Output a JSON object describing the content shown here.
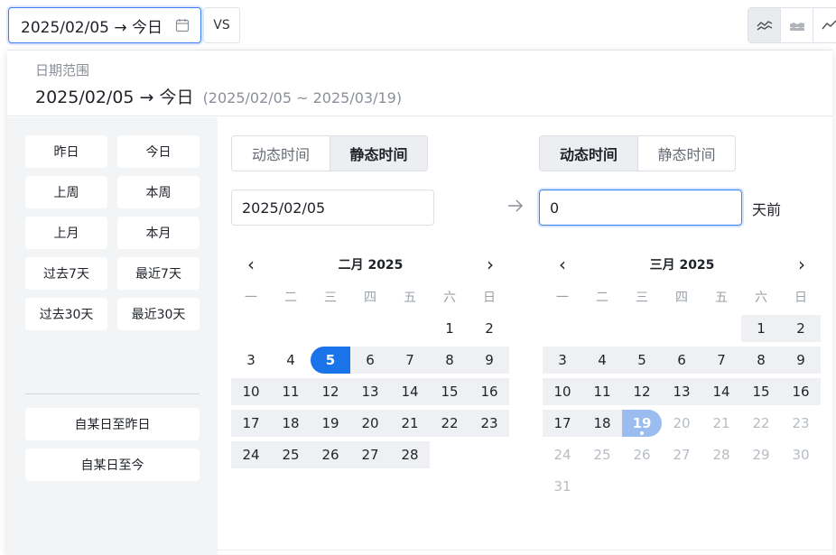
{
  "topbar": {
    "range_value": "2025/02/05 → 今日",
    "vs_label": "VS"
  },
  "panel": {
    "head_label": "日期范围",
    "head_value": "2025/02/05 → 今日",
    "head_sub": "(2025/02/05 ~ 2025/03/19)"
  },
  "quick": {
    "yesterday": "昨日",
    "today": "今日",
    "last_week": "上周",
    "this_week": "本周",
    "last_month": "上月",
    "this_month": "本月",
    "past_7": "过去7天",
    "recent_7": "最近7天",
    "past_30": "过去30天",
    "recent_30": "最近30天",
    "since_to_yesterday": "自某日至昨日",
    "since_to_today": "自某日至今"
  },
  "start": {
    "dynamic_label": "动态时间",
    "static_label": "静态时间",
    "active": "static",
    "date_value": "2025/02/05"
  },
  "end": {
    "dynamic_label": "动态时间",
    "static_label": "静态时间",
    "active": "dynamic",
    "days_value": "0",
    "suffix": "天前"
  },
  "weekdays": [
    "一",
    "二",
    "三",
    "四",
    "五",
    "六",
    "日"
  ],
  "cal_left": {
    "title": "二月 2025",
    "prev": "‹",
    "next": "›"
  },
  "cal_right": {
    "title": "三月 2025",
    "prev": "‹",
    "next": "›"
  },
  "colors": {
    "accent": "#1a73e8",
    "range_bg": "#eef0f3",
    "end_marker": "#9bbcf0"
  },
  "icons": [
    "calendar-icon",
    "line-chart-icon",
    "area-chart-icon",
    "bar-chart-icon",
    "arrow-right-icon"
  ]
}
